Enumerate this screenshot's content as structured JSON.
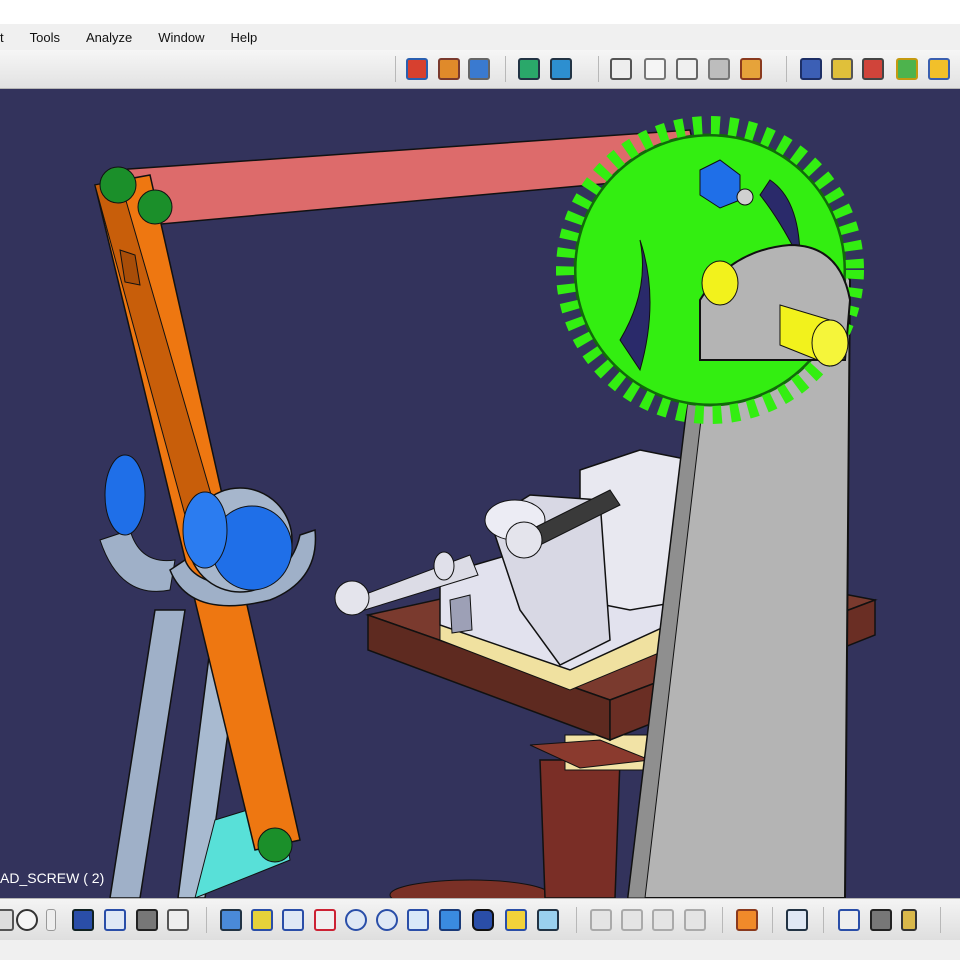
{
  "menu": {
    "items": [
      {
        "label": "t"
      },
      {
        "label": "Tools"
      },
      {
        "label": "Analyze"
      },
      {
        "label": "Window"
      },
      {
        "label": "Help"
      }
    ]
  },
  "toolbar_top": {
    "icons": [
      "product-structure-icon",
      "mechanism-icon",
      "catalog-icon",
      "clash-icon",
      "sectioning-icon",
      "measure-between-icon",
      "text-annotation-icon",
      "flag-note-icon",
      "snapshot-3d-icon",
      "weld-icon",
      "simulation-icon",
      "compile-simulation-icon",
      "replay-icon",
      "fix-icon",
      "sparkle-icon"
    ]
  },
  "toolbar_bottom": {
    "icons": [
      "fly-mode-icon",
      "comment-icon",
      "info-icon",
      "table-icon",
      "tree-expand-icon",
      "lock-icon",
      "hierarchy-icon",
      "fly-icon",
      "fit-all-icon",
      "pan-icon",
      "rotate-icon",
      "zoom-in-icon",
      "zoom-out-icon",
      "normal-view-icon",
      "iso-view-icon",
      "shading-icon",
      "hide-show-icon",
      "swap-space-icon",
      "cut-icon",
      "paste-icon",
      "copy-icon",
      "capture-icon",
      "update-icon",
      "dimension-icon",
      "properties-icon",
      "battery-icon"
    ]
  },
  "tree": {
    "node_label": "AD_SCREW ( 2)"
  },
  "colors": {
    "viewport_bg": "#33335c",
    "gear": "#33ee11",
    "link_orange": "#ee7711",
    "bar_pink": "#dd6b6b",
    "column_gray": "#b4b4b4",
    "vise_white": "#e4e4ee",
    "table_brown": "#7a3a2e",
    "pin_yellow": "#f2f21c",
    "pin_green": "#1b8f2a",
    "roller_blue": "#1f6fe8"
  }
}
